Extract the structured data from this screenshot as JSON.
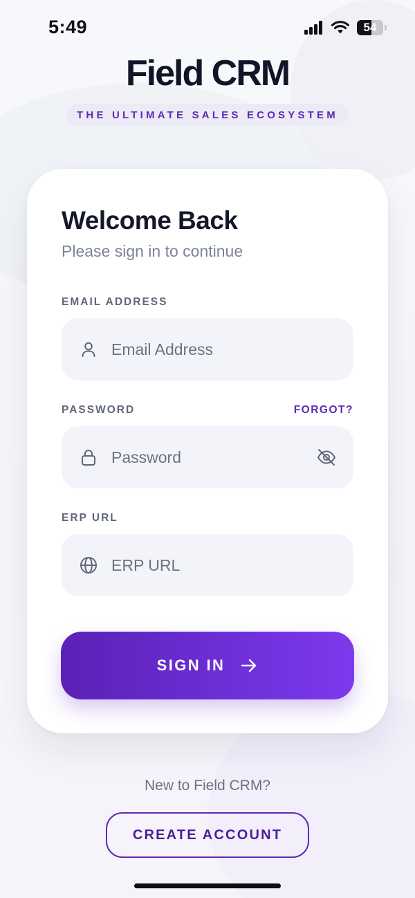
{
  "status_bar": {
    "time": "5:49",
    "battery_level": "54",
    "battery_fraction": 0.54
  },
  "brand": {
    "title": "Field CRM",
    "tagline": "THE ULTIMATE SALES ECOSYSTEM"
  },
  "login_card": {
    "title": "Welcome Back",
    "subtitle": "Please sign in to continue",
    "email": {
      "label": "EMAIL ADDRESS",
      "placeholder": "Email Address",
      "value": "",
      "icon": "user-icon"
    },
    "password": {
      "label": "PASSWORD",
      "forgot_label": "FORGOT?",
      "placeholder": "Password",
      "value": "",
      "icon": "lock-icon",
      "visibility_icon": "eye-off-icon"
    },
    "erp_url": {
      "label": "ERP URL",
      "placeholder": "ERP URL",
      "value": "",
      "icon": "globe-icon"
    },
    "sign_in_label": "SIGN IN",
    "sign_in_icon": "arrow-right-icon"
  },
  "footer": {
    "prompt": "New to Field CRM?",
    "create_account_label": "CREATE ACCOUNT"
  },
  "colors": {
    "accent": "#5b2ab8",
    "button_gradient_start": "#5b21b6",
    "button_gradient_end": "#7c3aed",
    "input_background": "#f2f4f9",
    "title_text": "#141828"
  }
}
